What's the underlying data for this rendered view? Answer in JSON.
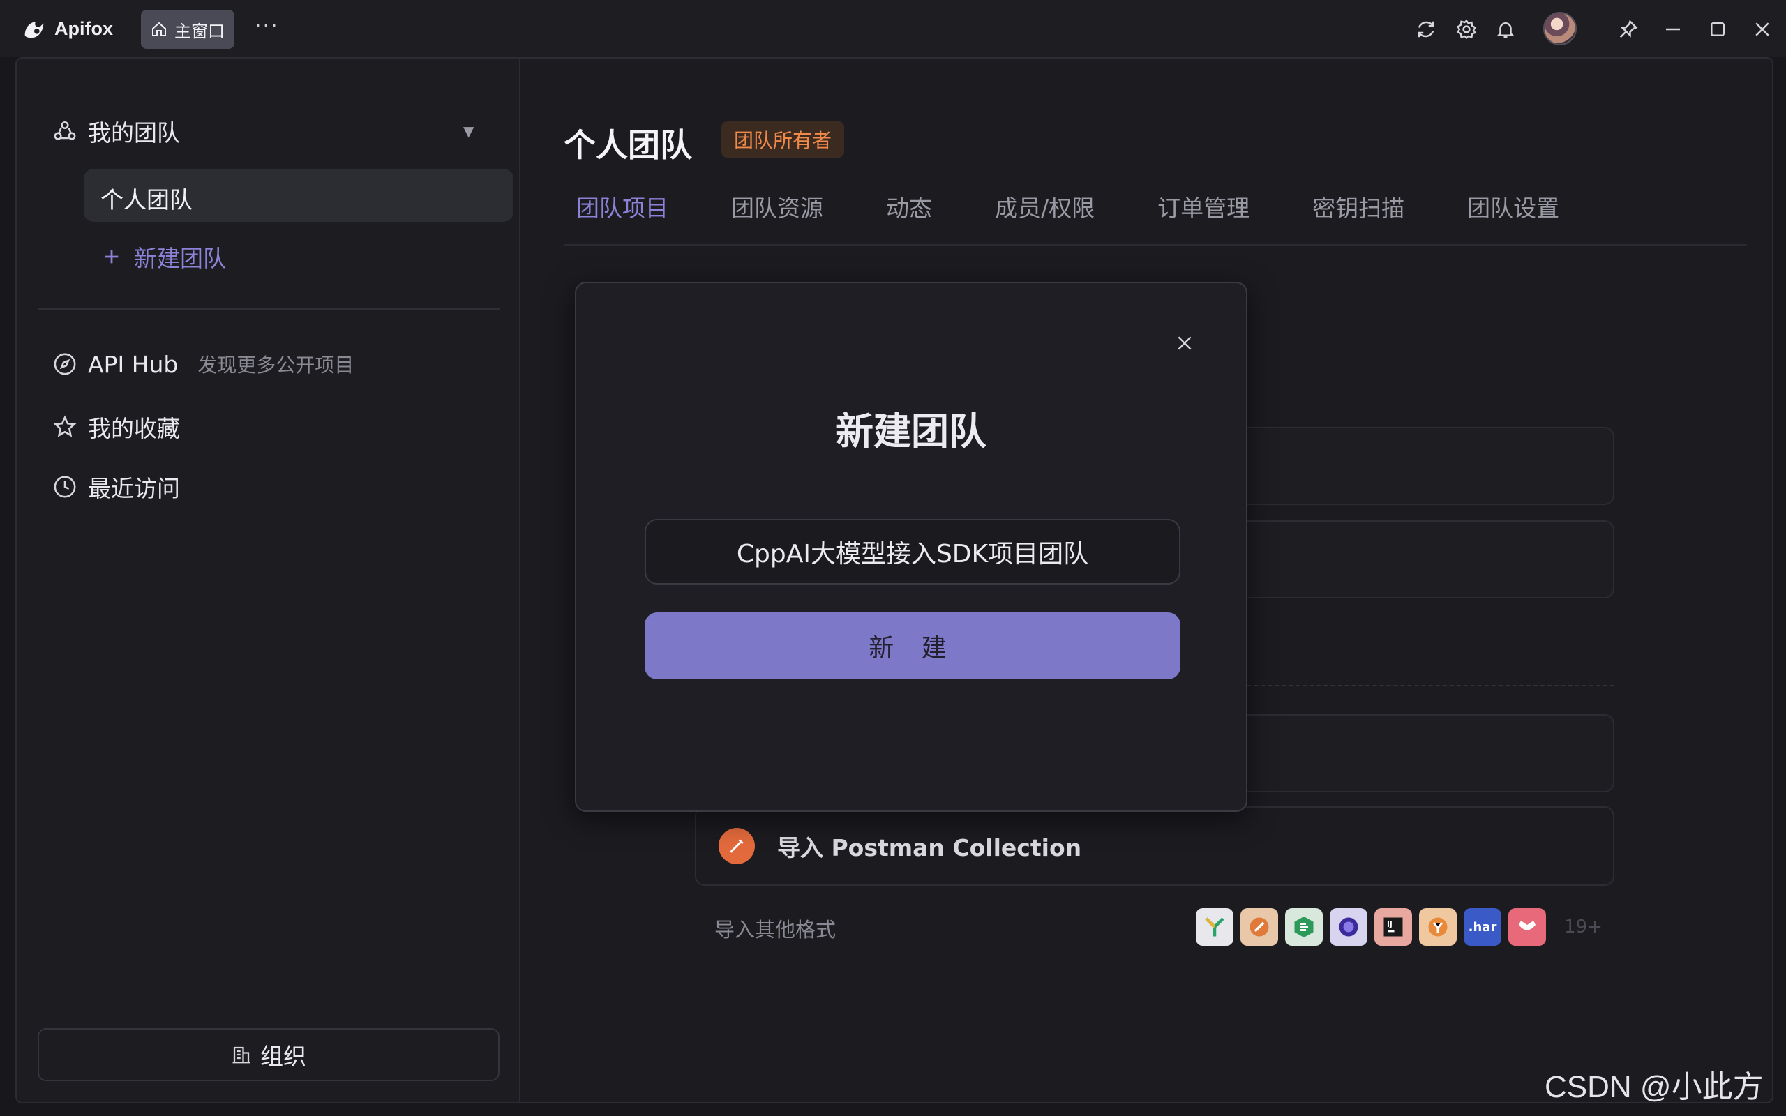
{
  "app": {
    "name": "Apifox",
    "main_tab": "主窗口",
    "more": "···"
  },
  "sidebar": {
    "my_team": "我的团队",
    "selected_team": "个人团队",
    "new_team": "新建团队",
    "api_hub": "API Hub",
    "api_hub_hint": "发现更多公开项目",
    "favorites": "我的收藏",
    "recent": "最近访问",
    "org": "组织"
  },
  "main": {
    "title": "个人团队",
    "badge": "团队所有者",
    "tabs": [
      {
        "label": "团队项目"
      },
      {
        "label": "团队资源"
      },
      {
        "label": "动态"
      },
      {
        "label": "成员/权限"
      },
      {
        "label": "订单管理"
      },
      {
        "label": "密钥扫描"
      },
      {
        "label": "团队设置"
      }
    ],
    "import_postman": "导入 Postman Collection",
    "other_formats": "导入其他格式",
    "format_har": ".har",
    "format_more": "19+"
  },
  "modal": {
    "title": "新建团队",
    "input_value": "CppAI大模型接入SDK项目团队",
    "button": "新 建"
  },
  "watermark": "CSDN @小此方",
  "colors": {
    "accent": "#8c83d8",
    "button": "#7e78c8",
    "badge_text": "#f08a4a",
    "postman": "#e36a3c"
  }
}
